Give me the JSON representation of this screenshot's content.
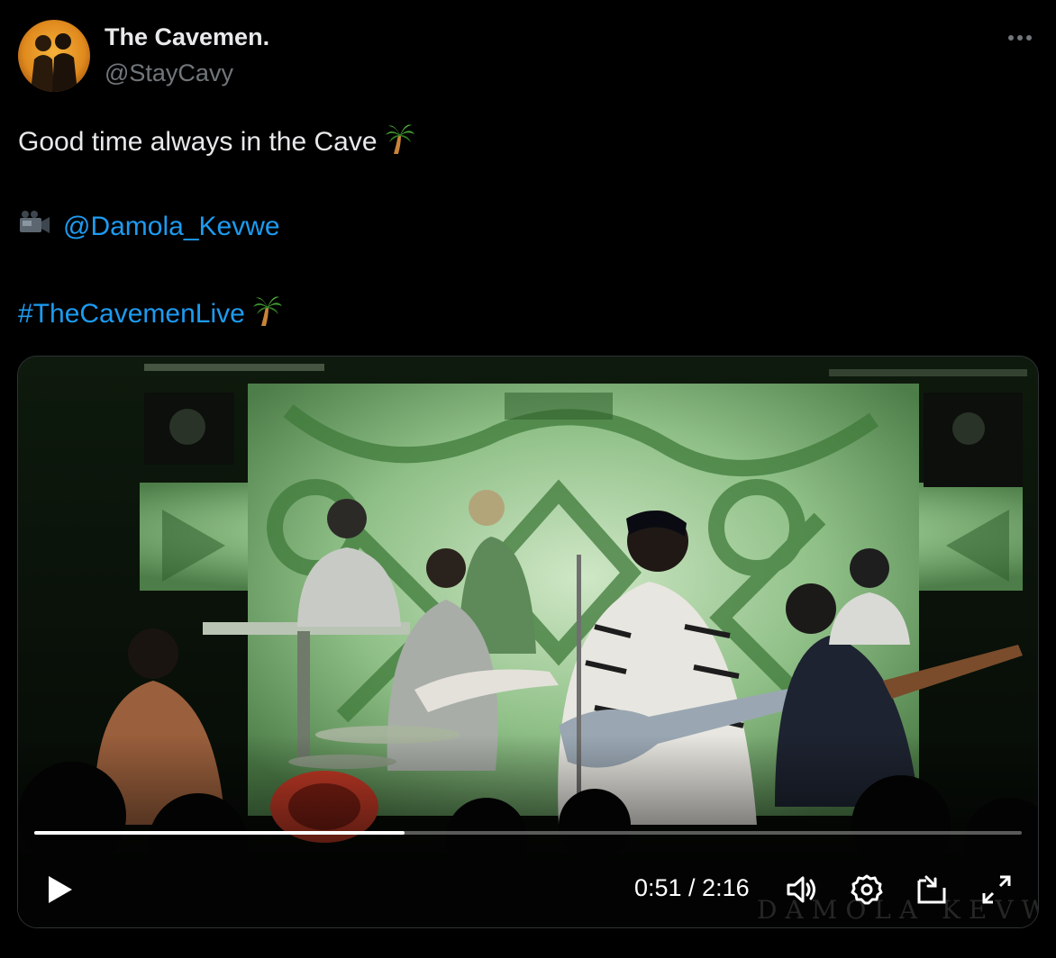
{
  "author": {
    "display_name": "The Cavemen.",
    "handle": "@StayCavy"
  },
  "tweet": {
    "text": "Good time always in the Cave",
    "text_emoji": "palm-tree-icon",
    "credit_icon": "video-camera-icon",
    "credit_mention": "@Damola_Kevwe",
    "hashtag": "#TheCavemenLive",
    "hashtag_emoji": "palm-tree-icon"
  },
  "video": {
    "current_time": "0:51",
    "duration": "2:16",
    "time_display": "0:51 / 2:16",
    "progress": 0.375,
    "watermark": "DAMOLA KEVWE",
    "controls": [
      "play-icon",
      "volume-icon",
      "settings-gear-icon",
      "picture-in-picture-icon",
      "fullscreen-icon"
    ]
  },
  "colors": {
    "background": "#000000",
    "primary_text": "#e7e9ea",
    "secondary_text": "#71767b",
    "link": "#1d9bf0",
    "stage_green": "#7fb77a"
  }
}
